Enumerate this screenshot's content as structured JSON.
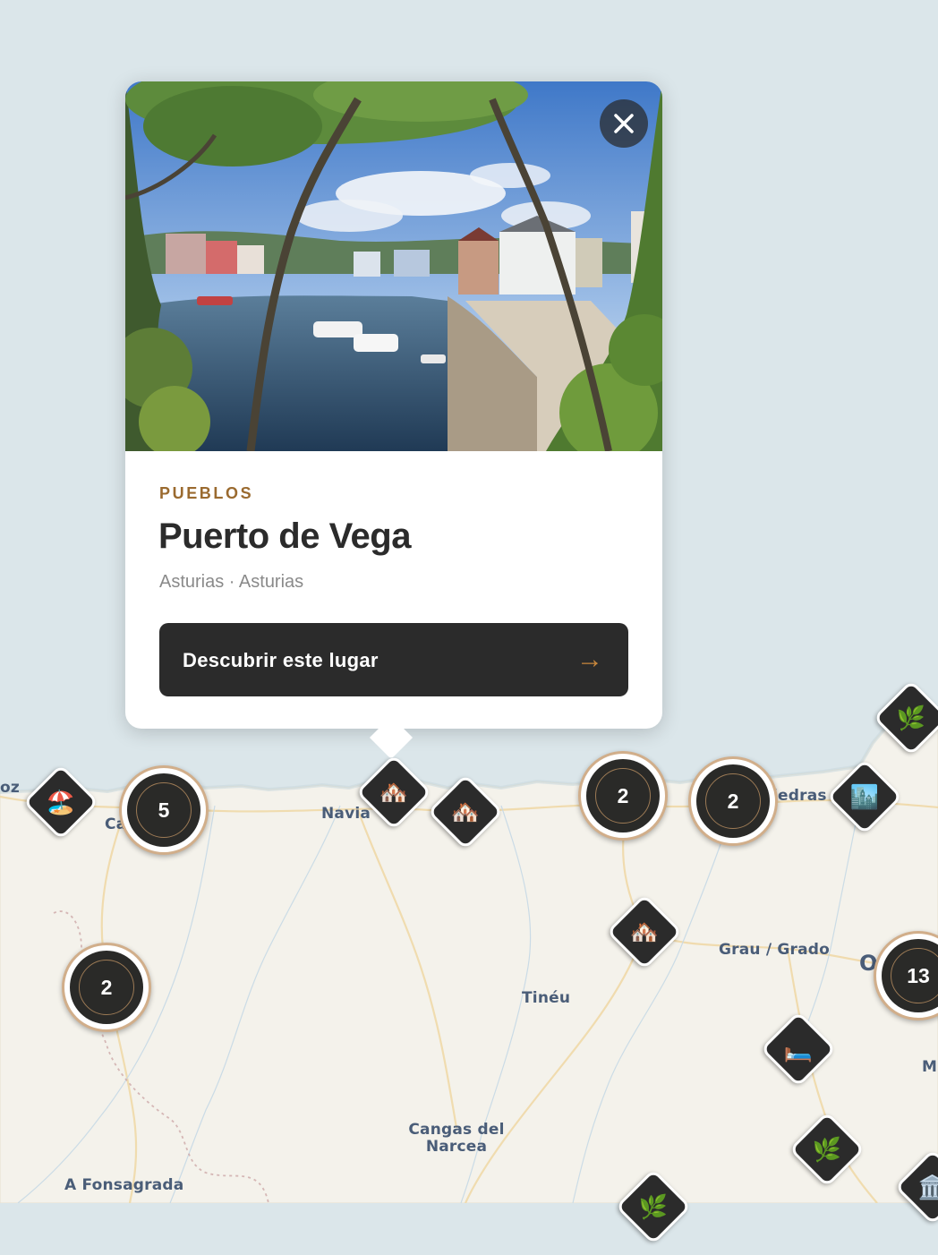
{
  "map": {
    "places": [
      {
        "id": "navia",
        "label": "Navia"
      },
      {
        "id": "grau",
        "label": "Grau / Grado"
      },
      {
        "id": "tineu",
        "label": "Tinéu"
      },
      {
        "id": "cangas",
        "label": "Cangas del Narcea"
      },
      {
        "id": "fonsagrada",
        "label": "A Fonsagrada"
      },
      {
        "id": "piedras",
        "label": "iedras"
      },
      {
        "id": "ca",
        "label": "Ca"
      },
      {
        "id": "oz",
        "label": "oz"
      },
      {
        "id": "m",
        "label": "M"
      },
      {
        "id": "o",
        "label": "O"
      }
    ],
    "clusters": [
      {
        "id": "cluster-5",
        "count": "5"
      },
      {
        "id": "cluster-2-a",
        "count": "2"
      },
      {
        "id": "cluster-2-b",
        "count": "2"
      },
      {
        "id": "cluster-2-c",
        "count": "2"
      },
      {
        "id": "cluster-13",
        "count": "13"
      }
    ],
    "markers": [
      {
        "id": "beach",
        "icon": "beach-icon",
        "glyph": "🏖️"
      },
      {
        "id": "town-1",
        "icon": "house-icon",
        "glyph": "🏘️"
      },
      {
        "id": "town-2",
        "icon": "house-icon",
        "glyph": "🏘️"
      },
      {
        "id": "town-3",
        "icon": "house-icon",
        "glyph": "🏘️"
      },
      {
        "id": "nature-1",
        "icon": "herb-icon",
        "glyph": "🌿"
      },
      {
        "id": "city",
        "icon": "city-icon",
        "glyph": "🏙️"
      },
      {
        "id": "hotel",
        "icon": "bed-icon",
        "glyph": "🛏️"
      },
      {
        "id": "nature-2",
        "icon": "herb-icon",
        "glyph": "🌿"
      },
      {
        "id": "nature-3",
        "icon": "herb-icon",
        "glyph": "🌿"
      },
      {
        "id": "museum",
        "icon": "museum-icon",
        "glyph": "🏛️"
      }
    ]
  },
  "popup": {
    "category": "PUEBLOS",
    "title": "Puerto de Vega",
    "location": "Asturias · Asturias",
    "cta_label": "Descubrir este lugar",
    "cta_arrow": "→",
    "close_glyph": "✕"
  },
  "colors": {
    "sea": "#dbe6ea",
    "land": "#f3f1ea",
    "marker": "#2b2b2b",
    "cluster_border": "#d1ae8a",
    "category": "#9a6a2f",
    "accent_arrow": "#c8873c"
  }
}
